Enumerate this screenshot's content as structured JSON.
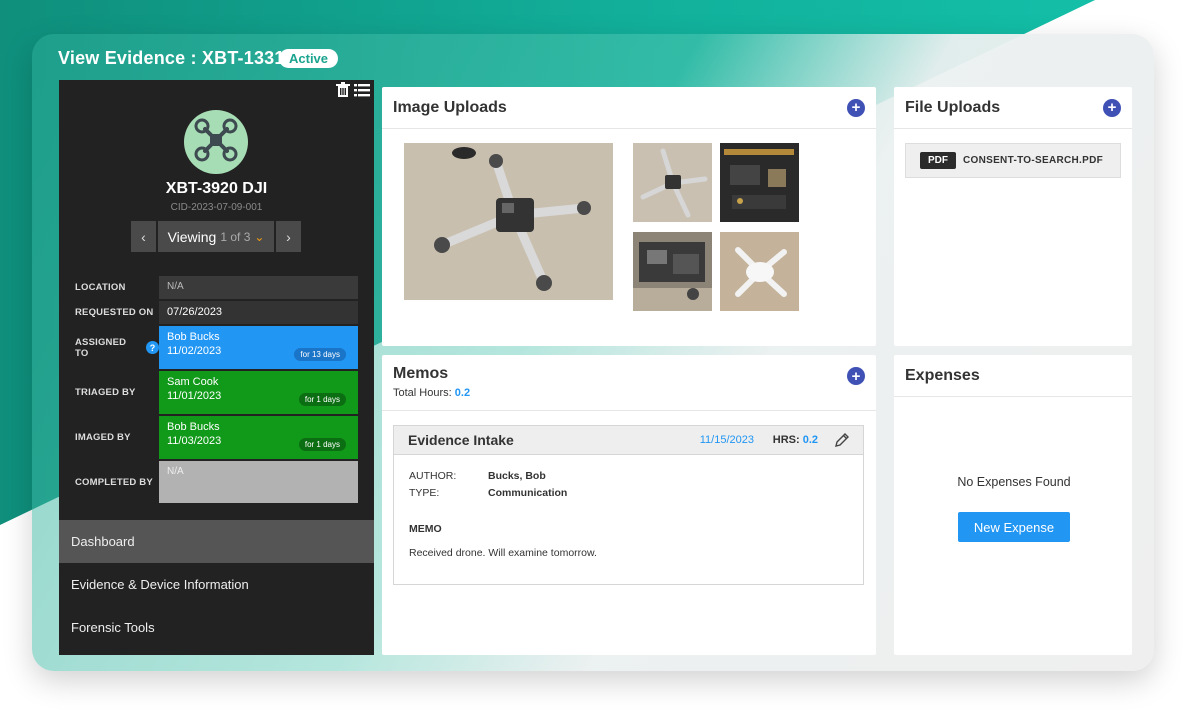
{
  "page": {
    "title": "View Evidence : XBT-1331",
    "status": "Active"
  },
  "evidence": {
    "name": "XBT-3920 DJI",
    "case_id": "CID-2023-07-09-001",
    "pager": {
      "label": "Viewing",
      "position": "1 of 3",
      "prev_icon": "chevron-left-icon",
      "next_icon": "chevron-right-icon"
    },
    "fields": [
      {
        "label": "LOCATION",
        "value": "N/A",
        "date": "",
        "duration": ""
      },
      {
        "label": "REQUESTED ON",
        "value": "07/26/2023",
        "date": "",
        "duration": ""
      },
      {
        "label": "ASSIGNED TO",
        "value": "Bob Bucks",
        "date": "11/02/2023",
        "duration": "for 13 days"
      },
      {
        "label": "TRIAGED BY",
        "value": "Sam Cook",
        "date": "11/01/2023",
        "duration": "for 1 days"
      },
      {
        "label": "IMAGED BY",
        "value": "Bob Bucks",
        "date": "11/03/2023",
        "duration": "for 1 days"
      },
      {
        "label": "COMPLETED BY",
        "value": "N/A",
        "date": "",
        "duration": ""
      }
    ]
  },
  "nav": {
    "items": [
      {
        "label": "Dashboard",
        "active": true
      },
      {
        "label": "Evidence & Device Information",
        "active": false
      },
      {
        "label": "Forensic Tools",
        "active": false
      }
    ]
  },
  "image_uploads": {
    "title": "Image Uploads"
  },
  "file_uploads": {
    "title": "File Uploads",
    "files": [
      {
        "type": "PDF",
        "name": "CONSENT-TO-SEARCH.PDF"
      }
    ]
  },
  "memos": {
    "title": "Memos",
    "total_hours_label": "Total Hours:",
    "total_hours": "0.2",
    "items": [
      {
        "title": "Evidence Intake",
        "date": "11/15/2023",
        "hrs_label": "HRS:",
        "hrs": "0.2",
        "author_label": "AUTHOR:",
        "author": "Bucks, Bob",
        "type_label": "TYPE:",
        "type": "Communication",
        "memo_label": "MEMO",
        "memo": "Received drone. Will examine tomorrow."
      }
    ]
  },
  "expenses": {
    "title": "Expenses",
    "empty_text": "No Expenses Found",
    "new_button": "New Expense"
  },
  "colors": {
    "accent_teal": "#12b19c",
    "primary_blue": "#2196f3",
    "indigo": "#3f51b5",
    "success_green": "#119a19"
  }
}
